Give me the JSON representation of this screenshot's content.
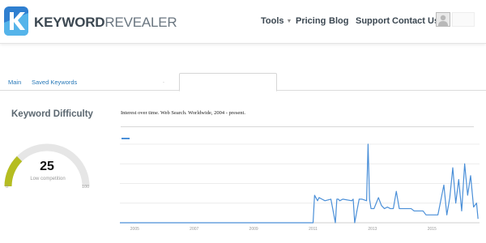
{
  "brand": {
    "name_bold": "KEYWORD",
    "name_light": "REVEALER",
    "mark": "K",
    "colors": {
      "mark_top": "#2f7fd0",
      "mark_bottom": "#55b4ea",
      "text": "#3b4751"
    }
  },
  "nav": {
    "items": [
      {
        "label": "Tools",
        "has_dropdown": true
      },
      {
        "label": "Pricing"
      },
      {
        "label": "Blog"
      },
      {
        "label": "Support"
      },
      {
        "label": "Contact Us"
      }
    ],
    "avatar_icon": "user-avatar-icon"
  },
  "tabs": {
    "items": [
      {
        "label": "Main"
      },
      {
        "label": "Saved Keywords"
      }
    ],
    "separator": ".",
    "active_tab_label": ""
  },
  "difficulty": {
    "title": "Keyword Difficulty",
    "value": 25,
    "value_text": "25",
    "label": "Low competition",
    "min": "0",
    "max": "100",
    "colors": {
      "fill": "#b5bd21",
      "track": "#e6e6e6"
    }
  },
  "trend": {
    "caption": "Interest over time. Web Search. Worldwide, 2004 - present.",
    "line_color": "#4a8fd8"
  },
  "chart_data": {
    "type": "line",
    "title": "Interest over time. Web Search. Worldwide, 2004 - present.",
    "xlabel": "",
    "ylabel": "",
    "xlim": [
      2004.5,
      2016.6
    ],
    "ylim": [
      0,
      100
    ],
    "grid": true,
    "x_ticks": [
      "2005",
      "2007",
      "2009",
      "2011",
      "2013",
      "2015"
    ],
    "series": [
      {
        "x": [
          2004.5,
          2009.5,
          2010.9,
          2011.0,
          2011.05,
          2011.15,
          2011.2,
          2011.3,
          2011.4,
          2011.6,
          2011.75,
          2011.8,
          2011.85,
          2011.9,
          2012.0,
          2012.3,
          2012.35,
          2012.4,
          2012.55,
          2012.6,
          2012.65,
          2012.8,
          2012.85,
          2012.9,
          2012.95,
          2013.05,
          2013.2,
          2013.3,
          2013.4,
          2013.5,
          2013.6,
          2013.7,
          2013.8,
          2013.9,
          2014.05,
          2014.15,
          2014.3,
          2014.4,
          2014.55,
          2014.7,
          2014.8,
          2015.2,
          2015.4,
          2015.5,
          2015.6,
          2015.7,
          2015.8,
          2015.9,
          2016.0,
          2016.1,
          2016.2,
          2016.3,
          2016.4,
          2016.5,
          2016.55
        ],
        "y": [
          0,
          0,
          0,
          0,
          35,
          28,
          32,
          30,
          28,
          30,
          0,
          30,
          30,
          28,
          30,
          28,
          30,
          0,
          30,
          30,
          30,
          28,
          100,
          30,
          18,
          18,
          32,
          22,
          18,
          20,
          18,
          18,
          40,
          18,
          18,
          18,
          18,
          15,
          15,
          15,
          10,
          10,
          48,
          10,
          32,
          70,
          25,
          55,
          15,
          75,
          35,
          60,
          20,
          25,
          5
        ]
      }
    ]
  }
}
